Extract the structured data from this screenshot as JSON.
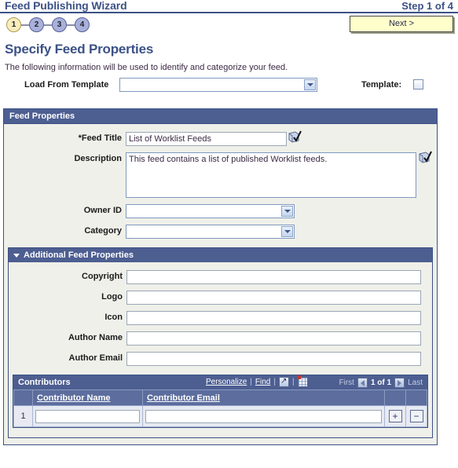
{
  "wizard": {
    "title": "Feed Publishing Wizard",
    "step_indicator": "Step 1 of 4",
    "steps": [
      {
        "number": "1",
        "state": "current"
      },
      {
        "number": "2",
        "state": "upcoming"
      },
      {
        "number": "3",
        "state": "upcoming"
      },
      {
        "number": "4",
        "state": "upcoming"
      }
    ],
    "next_button": "Next >"
  },
  "page": {
    "title": "Specify Feed Properties",
    "intro": "The following information will be used to identify and categorize your feed."
  },
  "template_row": {
    "load_from_template_label": "Load From Template",
    "load_from_template_value": "",
    "template_checkbox_label": "Template:",
    "template_checked": false
  },
  "feed_properties": {
    "section_title": "Feed Properties",
    "feed_title_label": "*Feed Title",
    "feed_title_value": "List of Worklist Feeds",
    "feed_title_placeholder": "",
    "description_label": "Description",
    "description_value": "This feed contains a list of published Worklist feeds.",
    "description_placeholder": "",
    "owner_id_label": "Owner ID",
    "owner_id_value": "",
    "category_label": "Category",
    "category_value": "",
    "spell_check_icon": "spell-check-icon"
  },
  "additional_properties": {
    "section_title": "Additional Feed Properties",
    "expanded": true,
    "collapse_icon": "triangle-down-icon",
    "fields": [
      {
        "label": "Copyright",
        "value": "",
        "name": "copyright"
      },
      {
        "label": "Logo",
        "value": "",
        "name": "logo"
      },
      {
        "label": "Icon",
        "value": "",
        "name": "icon"
      },
      {
        "label": "Author Name",
        "value": "",
        "name": "author-name"
      },
      {
        "label": "Author Email",
        "value": "",
        "name": "author-email"
      }
    ]
  },
  "contributors": {
    "section_title": "Contributors",
    "personalize_label": "Personalize",
    "find_label": "Find",
    "view_all_icon": "view-all-icon",
    "download_grid_icon": "download-to-spreadsheet-icon",
    "first_label": "First",
    "last_label": "Last",
    "page_indicator": "1 of 1",
    "prev_arrow_icon": "arrow-left-icon",
    "next_arrow_icon": "arrow-right-icon",
    "columns": [
      "",
      "Contributor Name",
      "Contributor Email",
      "",
      ""
    ],
    "rows": [
      {
        "row_number": "1",
        "contributor_name": "",
        "contributor_email": "",
        "add_button": "+",
        "delete_button": "−"
      }
    ]
  },
  "colors": {
    "header_blue": "#3c5186",
    "panel_head_blue": "#4d5e91",
    "panel_bg": "#eff0e9",
    "button_yellow": "#ffffcc",
    "current_step": "#f7edbd",
    "upcoming_step": "#a8b0dc"
  }
}
